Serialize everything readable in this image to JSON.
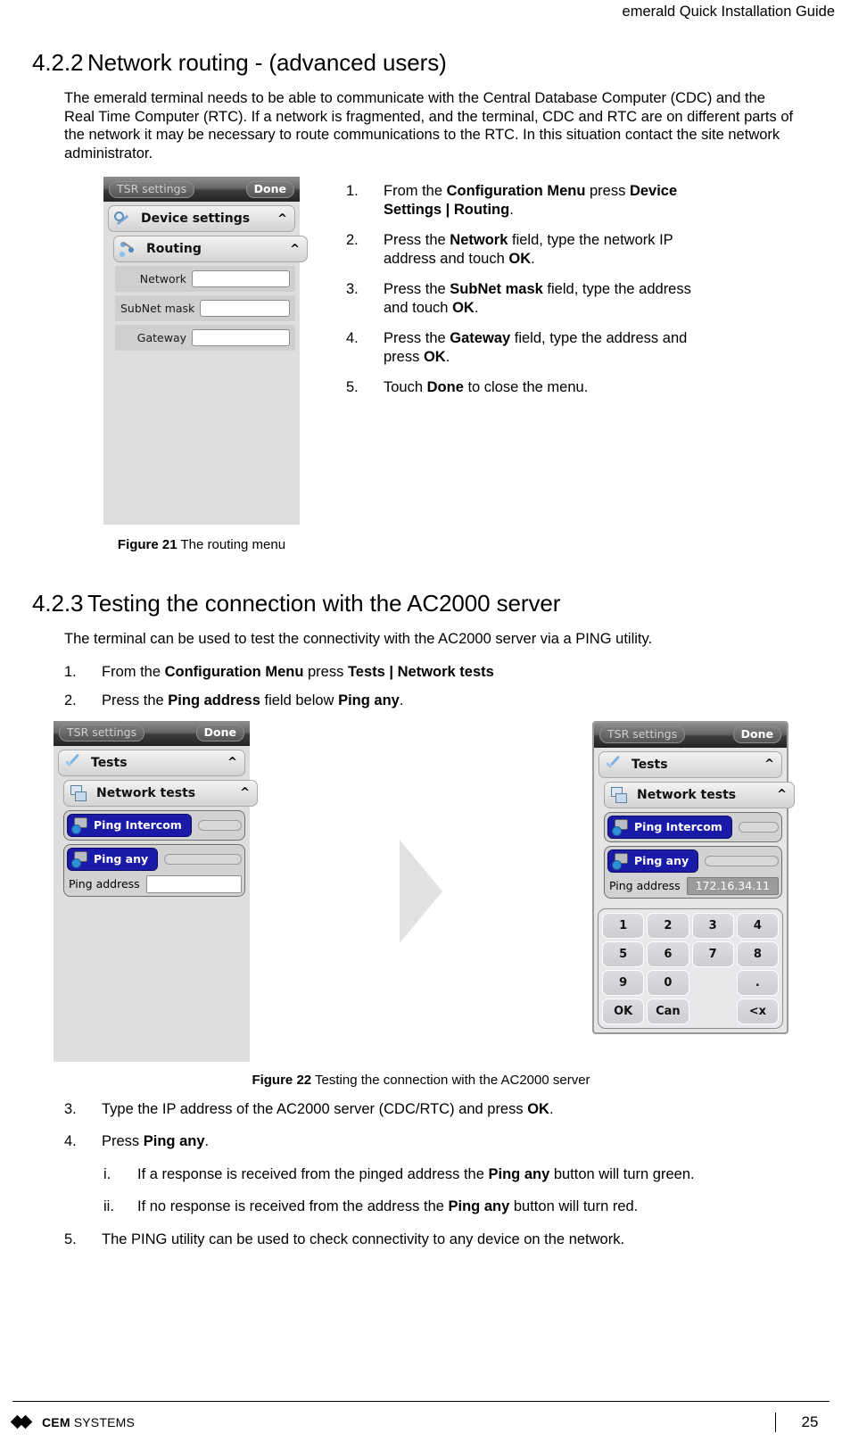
{
  "header": {
    "title": "emerald Quick Installation Guide"
  },
  "sections": {
    "s422": {
      "number": "4.2.2",
      "title": "Network routing - (advanced users)",
      "paragraph": "The emerald terminal needs to be able to communicate with the Central Database Computer (CDC) and the Real Time Computer (RTC). If a network is fragmented, and the terminal, CDC and RTC are on different parts of the network it may be necessary to route communications to the RTC. In this situation contact the site network administrator."
    },
    "s423": {
      "number": "4.2.3",
      "title": "Testing the connection with the AC2000 server",
      "paragraph": "The terminal can be used to test the connectivity with the AC2000 server via a PING utility."
    }
  },
  "steps_routing": [
    {
      "marker": "1.",
      "html": "From the <b>Configuration Menu</b> press <b>Device Settings | Routing</b>."
    },
    {
      "marker": "2.",
      "html": "Press the <b>Network</b> field, type the network IP address and touch <b>OK</b>."
    },
    {
      "marker": "3.",
      "html": "Press the <b>SubNet mask</b> field, type the address and touch <b>OK</b>."
    },
    {
      "marker": "4.",
      "html": "Press the <b>Gateway</b> field, type the address and press <b>OK</b>."
    },
    {
      "marker": "5.",
      "html": "Touch <b>Done</b> to close the menu."
    }
  ],
  "steps_testing_top": [
    {
      "marker": "1.",
      "html": "From the <b>Configuration Menu</b> press <b>Tests | Network tests</b>"
    },
    {
      "marker": "2.",
      "html": "Press the <b>Ping address</b> field below <b>Ping any</b>."
    }
  ],
  "steps_testing_bottom": [
    {
      "marker": "3.",
      "html": "Type the IP address of the AC2000 server (CDC/RTC) and press <b>OK</b>."
    },
    {
      "marker": "4.",
      "html": "Press <b>Ping any</b>."
    }
  ],
  "substeps_testing": [
    {
      "marker": "i.",
      "html": "If a response is received from the pinged address the <b>Ping any</b> button will turn green."
    },
    {
      "marker": "ii.",
      "html": "If no response is received from the address the <b>Ping any</b> button will turn red."
    }
  ],
  "steps_testing_last": [
    {
      "marker": "5.",
      "html": "The PING utility can be used to check connectivity to any device on the network."
    }
  ],
  "figures": {
    "fig21": {
      "label": "Figure 21",
      "caption": "The routing menu"
    },
    "fig22": {
      "label": "Figure 22",
      "caption": "Testing the connection with the AC2000 server"
    }
  },
  "device_routing": {
    "titlebar": {
      "title": "TSR settings",
      "done": "Done"
    },
    "menu_items": [
      {
        "label": "Device settings",
        "caret": "^",
        "icon": "wrench-icon"
      },
      {
        "label": "Routing",
        "caret": "^",
        "icon": "routing-icon"
      }
    ],
    "fields": [
      {
        "label": "Network",
        "value": ""
      },
      {
        "label": "SubNet mask",
        "value": ""
      },
      {
        "label": "Gateway",
        "value": ""
      }
    ]
  },
  "device_tests_before": {
    "titlebar": {
      "title": "TSR settings",
      "done": "Done"
    },
    "menu_items": [
      {
        "label": "Tests",
        "caret": "^",
        "icon": "check-icon"
      },
      {
        "label": "Network tests",
        "caret": "^",
        "icon": "network-test-icon"
      }
    ],
    "ping_buttons": [
      {
        "label": "Ping Intercom"
      },
      {
        "label": "Ping any"
      }
    ],
    "ping_address": {
      "label": "Ping address",
      "value": ""
    }
  },
  "device_tests_after": {
    "titlebar": {
      "title": "TSR settings",
      "done": "Done"
    },
    "menu_items": [
      {
        "label": "Tests",
        "caret": "^",
        "icon": "check-icon"
      },
      {
        "label": "Network tests",
        "caret": "^",
        "icon": "network-test-icon"
      }
    ],
    "ping_buttons": [
      {
        "label": "Ping Intercom"
      },
      {
        "label": "Ping any"
      }
    ],
    "ping_address": {
      "label": "Ping address",
      "value": "172.16.34.11"
    },
    "keypad": [
      "1",
      "2",
      "3",
      "4",
      "5",
      "6",
      "7",
      "8",
      "9",
      "0",
      "",
      ".",
      "OK",
      "Can",
      "",
      "<x"
    ]
  },
  "footer": {
    "logo_primary": "CEM",
    "logo_secondary": "SYSTEMS",
    "page_number": "25"
  },
  "colors": {
    "ping_button_blue": "#1a1aa8",
    "device_bg": "#dededd",
    "arrow_gray": "#e2e2e2"
  }
}
